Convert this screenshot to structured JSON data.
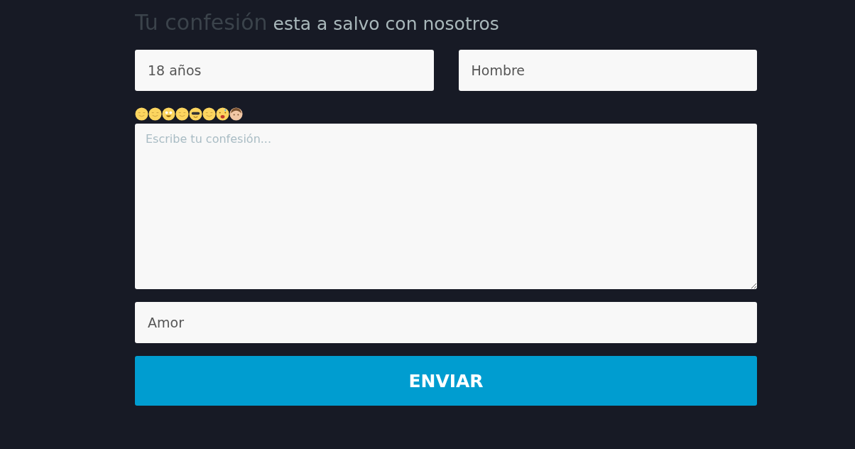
{
  "heading": {
    "lead": "Tu confesión",
    "rest": "esta a salvo con nosotros"
  },
  "age_field": {
    "value": "18 años"
  },
  "gender_field": {
    "value": "Hombre"
  },
  "confession_field": {
    "placeholder": "Escribe tu confesión..."
  },
  "category_field": {
    "value": "Amor"
  },
  "submit_button": {
    "label": "ENVIAR"
  }
}
